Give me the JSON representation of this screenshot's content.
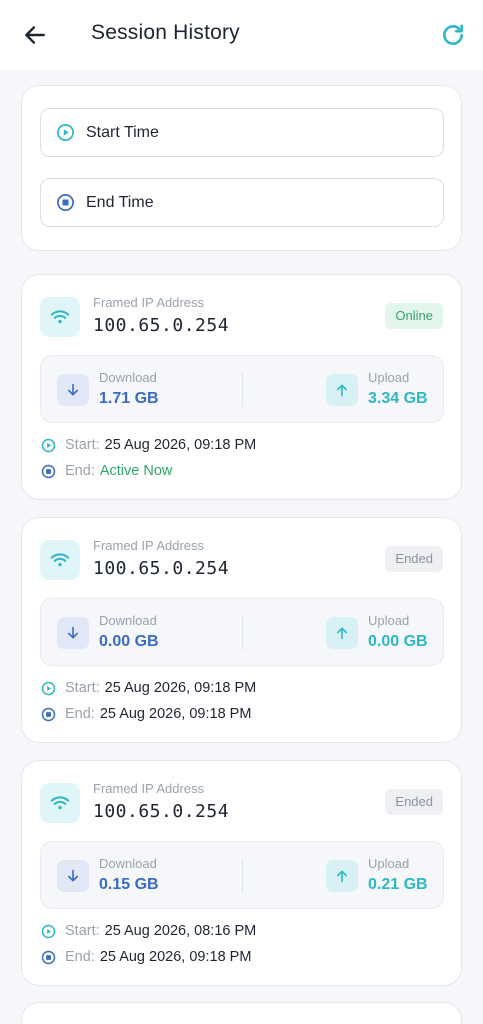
{
  "header": {
    "title": "Session History",
    "back_icon": "arrow-left-icon",
    "refresh_icon": "refresh-icon"
  },
  "colors": {
    "accent_teal": "#2eb7c5",
    "accent_blue": "#3a6bc2",
    "online_green": "#3aa36b"
  },
  "filters": {
    "start_label": "Start Time",
    "end_label": "End Time"
  },
  "sessions": [
    {
      "ip_caption": "Framed IP Address",
      "ip": "100.65.0.254",
      "status": "Online",
      "download_label": "Download",
      "download": "1.71 GB",
      "upload_label": "Upload",
      "upload": "3.34 GB",
      "start_label": "Start:",
      "start": "25 Aug 2026, 09:18 PM",
      "end_label": "End:",
      "end": "Active Now"
    },
    {
      "ip_caption": "Framed IP Address",
      "ip": "100.65.0.254",
      "status": "Ended",
      "download_label": "Download",
      "download": "0.00 GB",
      "upload_label": "Upload",
      "upload": "0.00 GB",
      "start_label": "Start:",
      "start": "25 Aug 2026, 09:18 PM",
      "end_label": "End:",
      "end": "25 Aug 2026, 09:18 PM"
    },
    {
      "ip_caption": "Framed IP Address",
      "ip": "100.65.0.254",
      "status": "Ended",
      "download_label": "Download",
      "download": "0.15 GB",
      "upload_label": "Upload",
      "upload": "0.21 GB",
      "start_label": "Start:",
      "start": "25 Aug 2026, 08:16 PM",
      "end_label": "End:",
      "end": "25 Aug 2026, 09:18 PM"
    }
  ]
}
